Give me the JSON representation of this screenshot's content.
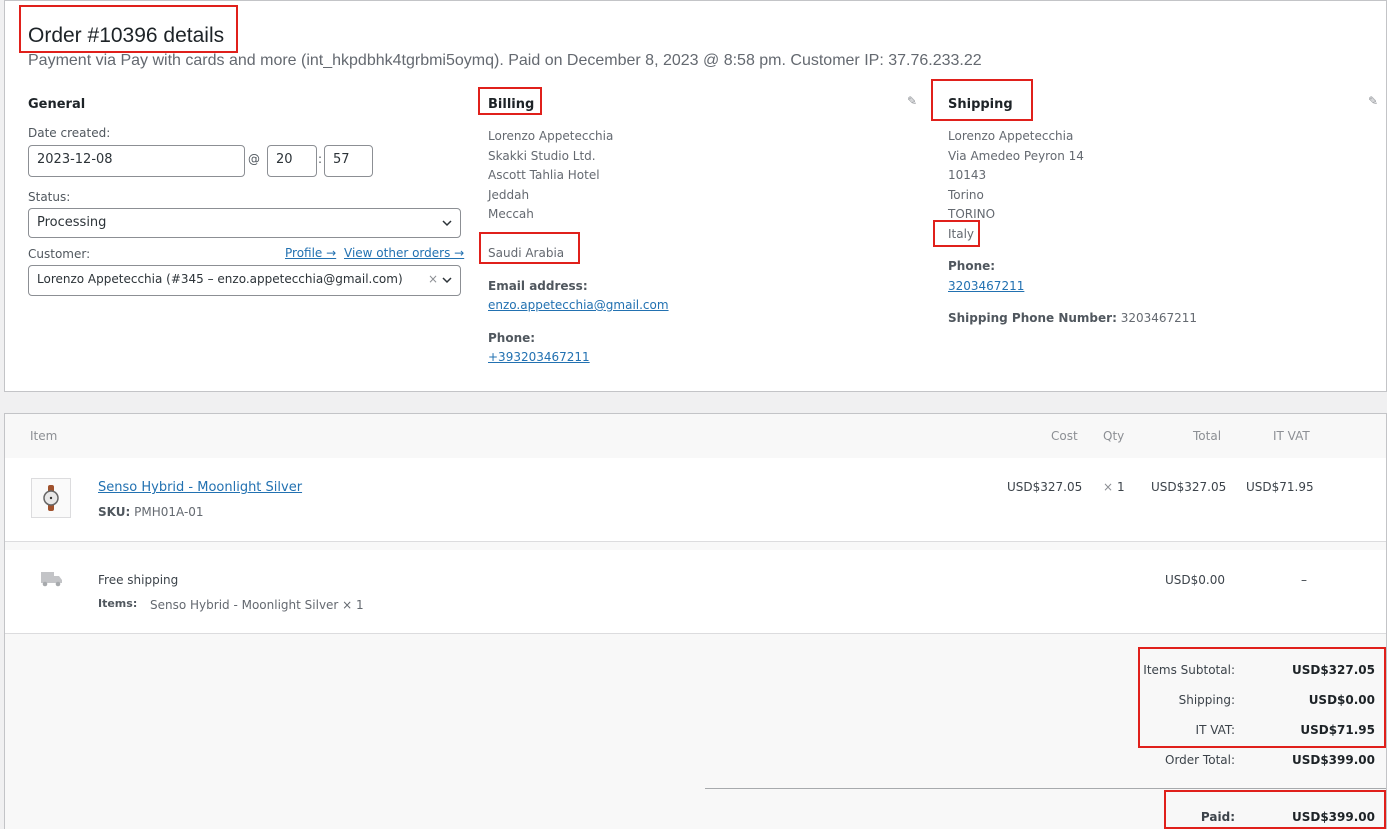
{
  "header": {
    "title": "Order #10396 details",
    "subtitle": "Payment via Pay with cards and more (int_hkpdbhk4tgrbmi5oymq). Paid on December 8, 2023 @ 8:58 pm. Customer IP: 37.76.233.22"
  },
  "general": {
    "heading": "General",
    "date_label": "Date created:",
    "date_value": "2023-12-08",
    "at": "@",
    "hour": "20",
    "colon": ":",
    "minute": "57",
    "status_label": "Status:",
    "status_value": "Processing",
    "customer_label": "Customer:",
    "profile_link": "Profile →",
    "other_orders_link": "View other orders →",
    "customer_value": "Lorenzo Appetecchia (#345 – enzo.appetecchia@gmail.com)",
    "clear": "×"
  },
  "billing": {
    "heading": "Billing",
    "name": "Lorenzo Appetecchia",
    "company": "Skakki Studio Ltd.",
    "address1": "Ascott Tahlia Hotel",
    "city": "Jeddah",
    "state": "Meccah",
    "country": "Saudi Arabia",
    "email_label": "Email address:",
    "email": "enzo.appetecchia@gmail.com",
    "phone_label": "Phone:",
    "phone": "+393203467211"
  },
  "shipping": {
    "heading": "Shipping",
    "name": "Lorenzo Appetecchia",
    "address1": "Via Amedeo Peyron 14",
    "postcode": "10143",
    "city": "Torino",
    "state": "TORINO",
    "country": "Italy",
    "phone_label": "Phone:",
    "phone": "3203467211",
    "ship_phone_label": "Shipping Phone Number:",
    "ship_phone": "3203467211"
  },
  "items_table": {
    "headers": {
      "item": "Item",
      "cost": "Cost",
      "qty": "Qty",
      "total": "Total",
      "vat": "IT VAT"
    },
    "product": {
      "name": "Senso Hybrid - Moonlight Silver",
      "sku_label": "SKU:",
      "sku": "PMH01A-01",
      "cost": "USD$327.05",
      "qty_x": "×",
      "qty": "1",
      "total": "USD$327.05",
      "vat": "USD$71.95"
    },
    "shipping_line": {
      "name": "Free shipping",
      "items_label": "Items:",
      "items": "Senso Hybrid - Moonlight Silver × 1",
      "total": "USD$0.00",
      "vat": "–"
    }
  },
  "totals": {
    "subtotal_label": "Items Subtotal:",
    "subtotal": "USD$327.05",
    "shipping_label": "Shipping:",
    "shipping": "USD$0.00",
    "vat_label": "IT VAT:",
    "vat": "USD$71.95",
    "order_total_label": "Order Total:",
    "order_total": "USD$399.00",
    "paid_label": "Paid:",
    "paid": "USD$399.00"
  },
  "colors": {
    "accent_link": "#2271b1",
    "highlight": "#e0201b"
  },
  "icons": [
    "pencil-icon",
    "chevron-down-icon",
    "truck-icon",
    "watch-thumbnail"
  ]
}
